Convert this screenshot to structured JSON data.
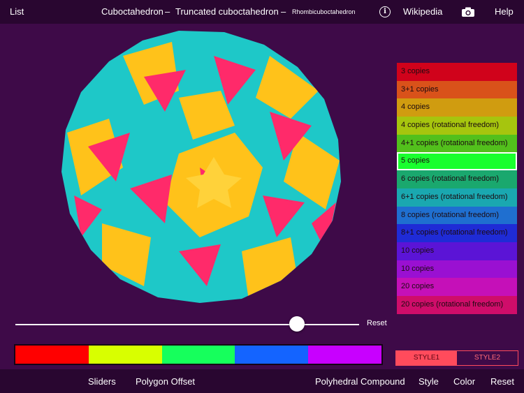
{
  "topbar": {
    "list_label": "List",
    "breadcrumb_1": "Cuboctahedron",
    "sep_1": "–",
    "breadcrumb_2": "Truncated cuboctahedron",
    "sep_2": "–",
    "breadcrumb_3": "Rhombicuboctahedron",
    "info_glyph": "i",
    "wikipedia_label": "Wikipedia",
    "help_label": "Help"
  },
  "compound_list": [
    {
      "label": "3 copies",
      "color": "#d0021b"
    },
    {
      "label": "3+1 copies",
      "color": "#d9521a"
    },
    {
      "label": "4 copies",
      "color": "#d09c10"
    },
    {
      "label": "4 copies (rotational freedom)",
      "color": "#a6c50e"
    },
    {
      "label": "4+1 copies (rotational freedom)",
      "color": "#52c01c"
    },
    {
      "label": "5 copies",
      "color": "#19ff2e",
      "selected": true
    },
    {
      "label": "6 copies (rotational freedom)",
      "color": "#1aa86e"
    },
    {
      "label": "6+1 copies (rotational freedom)",
      "color": "#1aa8b0"
    },
    {
      "label": "8 copies (rotational freedom)",
      "color": "#1f6fd0"
    },
    {
      "label": "8+1 copies (rotational freedom)",
      "color": "#1f2bd6"
    },
    {
      "label": "10 copies",
      "color": "#5b14d6"
    },
    {
      "label": "10 copies",
      "color": "#9a10d2"
    },
    {
      "label": "20 copies",
      "color": "#c510b8"
    },
    {
      "label": "20 copies (rotational freedom)",
      "color": "#cf0d6a"
    }
  ],
  "slider": {
    "value_fraction": 0.82,
    "reset_label": "Reset"
  },
  "palette": [
    "#ff0000",
    "#d8ff00",
    "#16ff5c",
    "#1464ff",
    "#c800ff"
  ],
  "style_toggle": {
    "style1": "STYLE1",
    "style2": "STYLE2",
    "active": "STYLE1"
  },
  "bottombar": {
    "sliders": "Sliders",
    "polygon_offset": "Polygon Offset",
    "polyhedral_compound": "Polyhedral Compound",
    "style": "Style",
    "color": "Color",
    "reset": "Reset"
  },
  "colors": {
    "background": "#3e0a48",
    "bar": "#290630",
    "face_yellow": "#ffc21a",
    "face_cyan": "#1ec8c8",
    "face_pink": "#ff2a6a",
    "accent": "#ff4b5c"
  }
}
